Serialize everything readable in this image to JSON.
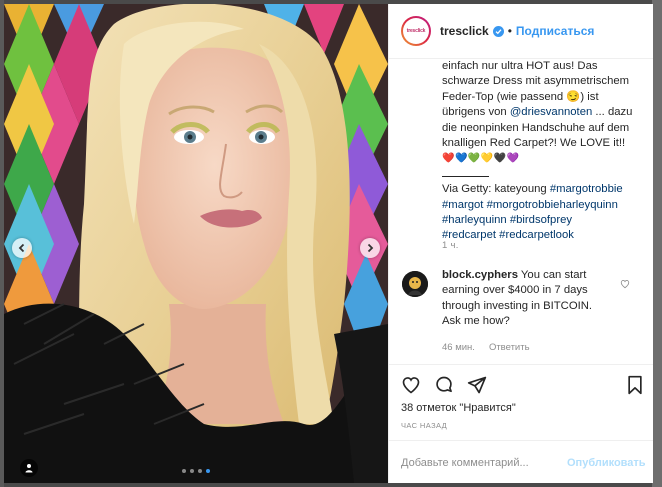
{
  "post": {
    "username": "tresclick",
    "follow_label": "Подписаться",
    "separator": "•",
    "avatar_text": "tresclick",
    "caption_lines": [
      "einfach nur ultra HOT aus! Das",
      "schwarze Dress mit asymmetrischem",
      "Feder-Top (wie passend 😏) ist",
      "übrigens von ",
      " ... dazu",
      "die neonpinken Handschuhe auf dem",
      "knalligen Red Carpet?! We LOVE it!!"
    ],
    "mention": "@driesvannoten",
    "emojis": "❤️💙💚💛🖤💜",
    "credit": "Via Getty: kateyoung",
    "hashtags": [
      "#margotrobbie",
      "#margot",
      "#morgotrobbieharleyquinn",
      "#harleyquinn",
      "#birdsofprey",
      "#redcarpet",
      "#redcarpetlook"
    ],
    "time": "1 ч."
  },
  "comment": {
    "username": "block.cyphers",
    "text": "You can start earning over $4000 in 7 days through investing in BITCOIN. Ask me how?",
    "time": "46 мин.",
    "reply_label": "Ответить"
  },
  "stats": {
    "likes_text": "38 отметок \"Нравится\"",
    "ago_text": "ЧАС НАЗАД"
  },
  "add_comment": {
    "placeholder": "Добавьте комментарий...",
    "publish_label": "Опубликовать"
  },
  "carousel": {
    "count": 4,
    "active_index": 3
  },
  "colors": {
    "accent": "#3897f0",
    "publish_disabled": "#b2dffc",
    "muted": "#8e8e8e"
  }
}
